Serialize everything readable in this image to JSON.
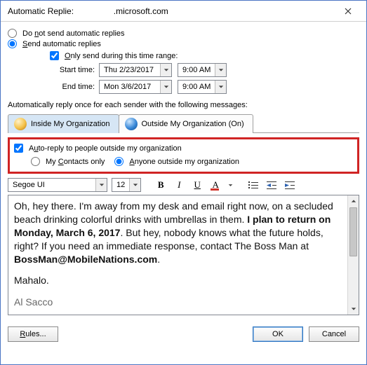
{
  "window": {
    "title_prefix": "Automatic Replie:",
    "title_suffix": ".microsoft.com"
  },
  "mode": {
    "do_not_send": "Do not send automatic replies",
    "send": "Send automatic replies"
  },
  "range": {
    "only_send": "Only send during this time range:",
    "start_label": "Start time:",
    "start_date": "Thu 2/23/2017",
    "start_time": "9:00 AM",
    "end_label": "End time:",
    "end_date": "Mon 3/6/2017",
    "end_time": "9:00 AM"
  },
  "reply_once": "Automatically reply once for each sender with the following messages:",
  "tabs": {
    "inside": "Inside My Organization",
    "outside": "Outside My Organization (On)"
  },
  "outside": {
    "auto_reply": "Auto-reply to people outside my organization",
    "contacts_only": "My Contacts only",
    "anyone": "Anyone outside my organization"
  },
  "format": {
    "font": "Segoe UI",
    "size": "12"
  },
  "message": {
    "p1a": "Oh, hey there. I'm away from my desk and email right now, on a secluded beach drinking colorful drinks with umbrellas in them. ",
    "p1b": "I plan to return on Monday, March 6, 2017",
    "p1c": ". But hey, nobody knows what the future holds, right? If you need an immediate response, contact The Boss Man at ",
    "p1d": "BossMan@MobileNations.com",
    "p1e": ".",
    "p2": "Mahalo.",
    "p3": "Al Sacco"
  },
  "footer": {
    "rules": "Rules...",
    "ok": "OK",
    "cancel": "Cancel"
  }
}
